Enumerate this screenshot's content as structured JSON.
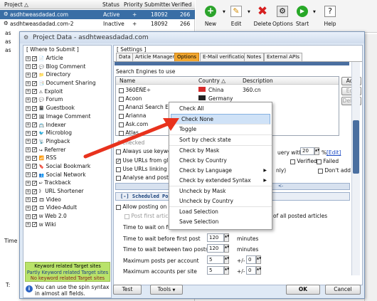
{
  "colors": {
    "titlebar": "#dce6f2",
    "accent": "#3a6ea5",
    "arrow": "#e8321d",
    "legend_green": "#b9e36a"
  },
  "proj_grid": {
    "headers": [
      "Project",
      "Status",
      "Priority",
      "Submitted",
      "Verified"
    ],
    "rows": [
      {
        "name": "asdhtweasdadad.com",
        "status": "Active",
        "priority": "+",
        "submitted": "18092",
        "verified": "266"
      },
      {
        "name": "asdhtweasdadad.com-2",
        "status": "Inactive",
        "priority": "+",
        "submitted": "18092",
        "verified": "266"
      },
      {
        "name": "as",
        "status": "",
        "priority": "",
        "submitted": "",
        "verified": ""
      },
      {
        "name": "as",
        "status": "",
        "priority": "",
        "submitted": "",
        "verified": ""
      },
      {
        "name": "as",
        "status": "",
        "priority": "",
        "submitted": "",
        "verified": ""
      }
    ],
    "time_label": "Time",
    "t_label": "T:"
  },
  "toolbar": {
    "new": "New",
    "edit": "Edit",
    "delete": "Delete",
    "options": "Options",
    "start": "Start",
    "help": "Help"
  },
  "dialog": {
    "title": "Project Data - asdhtweasdadad.com",
    "where_group": "[ Where to Submit ]",
    "settings_group": "[ Settings ]",
    "targets": [
      "Article",
      "Blog Comment",
      "Directory",
      "Document Sharing",
      "Exploit",
      "Forum",
      "Guestbook",
      "Image Comment",
      "Indexer",
      "Microblog",
      "Pingback",
      "Referrer",
      "RSS",
      "Social Bookmark",
      "Social Network",
      "Trackback",
      "URL Shortener",
      "Video",
      "Video-Adult",
      "Web 2.0",
      "Wiki"
    ],
    "legend": [
      "Keyword related Target sites",
      "Partly Keyword related Target sites",
      "No keyword related Target sites"
    ],
    "spin_hint": "You can use the spin syntax in almost all fields.",
    "tabs": [
      "Data",
      "Article Manager",
      "Options",
      "E-Mail verification",
      "Notes",
      "External APIs"
    ],
    "engines_label": "Search Engines to use",
    "engine_cols": [
      "Name",
      "Country",
      "Description"
    ],
    "engines": [
      {
        "name": "360ËÑË÷",
        "country": "China",
        "desc": "360.cn"
      },
      {
        "name": "Acoon",
        "country": "Germany",
        "desc": ""
      },
      {
        "name": "Ananzi Search Eng",
        "country": "",
        "desc": ""
      },
      {
        "name": "Arianna",
        "country": "",
        "desc": ""
      },
      {
        "name": "Ask.com",
        "country": "",
        "desc": ""
      },
      {
        "name": "Atlas",
        "country": "",
        "desc": ""
      }
    ],
    "engines_checked": "0 checked",
    "btn_add": "Add",
    "btn_edit": "Edit",
    "btn_delete": "Delete",
    "opt_use_keywords": "Always use keywords",
    "opt_use_urls_global": "Use URLs from globa",
    "opt_use_urls_linking": "Use URLs linking on",
    "opt_analyse": "Analyse and post to c",
    "query_with": "uery with",
    "query_value": "20",
    "percent": "%",
    "edit_link": "[Edit]",
    "verified_opt": "Verified",
    "failed_opt": "Failed",
    "dont_add": "Don't add",
    "only": "nly)",
    "arrow_text": "<-",
    "scheduled_header": "[-] Scheduled Po",
    "allow_posting": "Allow posting on sam",
    "post_first": "Post first article w",
    "all_posted": "of all posted articles",
    "time_further": "Time to wait on furth",
    "time_first": "Time to wait before first post",
    "time_first_val": "120",
    "time_between": "Time to wait between two posts",
    "time_between_val": "120",
    "minutes": "minutes",
    "max_posts": "Maximum posts per account",
    "max_posts_val": "5",
    "max_accounts": "Maximum accounts per site",
    "max_accounts_val": "5",
    "pm": "+/-",
    "pm_val": "0",
    "btn_test": "Test",
    "btn_tools": "Tools",
    "btn_ok": "OK",
    "btn_cancel": "Cancel"
  },
  "context_menu": [
    "Check All",
    "Check None",
    "Toggle",
    "Sort by check state",
    "Check by Mask",
    "Check by Country",
    "Check by Language",
    "Check by extended Syntax",
    "Uncheck by Mask",
    "Uncheck by Country",
    "Load Selection",
    "Save Selection"
  ]
}
